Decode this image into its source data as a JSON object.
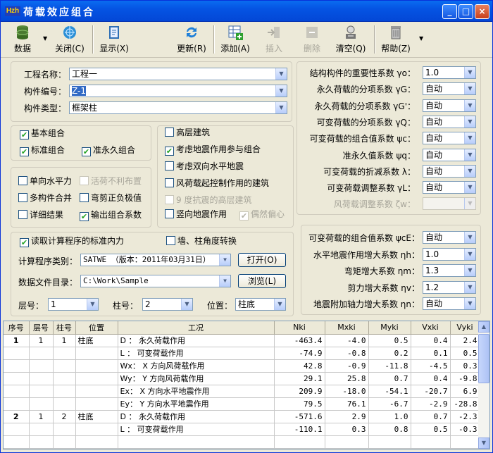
{
  "window": {
    "title": "荷载效应组合",
    "app_icon": "Hzh",
    "controls": [
      "_",
      "□",
      "×"
    ]
  },
  "toolbar": {
    "items": [
      {
        "label": "数据",
        "dropdown": true
      },
      {
        "label": "关闭(C)"
      },
      {
        "label": "显示(X)"
      },
      {
        "label": "更新(R)"
      },
      {
        "label": "添加(A)"
      },
      {
        "label": "插入",
        "disabled": true
      },
      {
        "label": "删除",
        "disabled": true
      },
      {
        "label": "清空(Q)"
      },
      {
        "label": "帮助(Z)",
        "dropdown": true
      }
    ]
  },
  "project": {
    "name_label": "工程名称：",
    "name_value": "工程一",
    "code_label": "构件编号：",
    "code_value": "Z-1",
    "type_label": "构件类型：",
    "type_value": "框架柱"
  },
  "combo_group": {
    "basic": {
      "label": "基本组合",
      "checked": true
    },
    "standard": {
      "label": "标准组合",
      "checked": true
    },
    "quasi": {
      "label": "准永久组合",
      "checked": true
    }
  },
  "options": [
    {
      "label": "单向水平力",
      "checked": false
    },
    {
      "label": "活荷不利布置",
      "checked": false,
      "disabled": true
    },
    {
      "label": "多构件合并",
      "checked": false
    },
    {
      "label": "弯剪正负极值",
      "checked": false
    },
    {
      "label": "详细结果",
      "checked": false
    },
    {
      "label": "输出组合系数",
      "checked": true
    }
  ],
  "seismic": [
    {
      "label": "高层建筑",
      "checked": false
    },
    {
      "label": "考虑地震作用参与组合",
      "checked": true
    },
    {
      "label": "考虑双向水平地震",
      "checked": false
    },
    {
      "label": "风荷载起控制作用的建筑",
      "checked": false
    },
    {
      "label": "9 度抗震的高层建筑",
      "checked": false,
      "disabled": true
    },
    {
      "label": "竖向地震作用",
      "checked": false
    },
    {
      "label": "偶然偏心",
      "checked": true,
      "disabled": true
    }
  ],
  "factors": [
    {
      "label": "结构构件的重要性系数 γo：",
      "value": "1.0"
    },
    {
      "label": "永久荷载的分项系数 γG：",
      "value": "自动"
    },
    {
      "label": "永久荷载的分项系数 γG'：",
      "value": "自动"
    },
    {
      "label": "可变荷载的分项系数 γQ：",
      "value": "自动"
    },
    {
      "label": "可变荷载的组合值系数 ψc：",
      "value": "自动"
    },
    {
      "label": "准永久值系数 ψq：",
      "value": "自动"
    },
    {
      "label": "可变荷载的折减系数 λ：",
      "value": "自动"
    },
    {
      "label": "可变荷载调整系数 γL：",
      "value": "自动"
    },
    {
      "label": "风荷载调整系数 ζw：",
      "value": "",
      "disabled": true
    }
  ],
  "read": {
    "label": "读取计算程序的标准内力",
    "checked": true,
    "rotate_label": "墙、柱角度转换",
    "rotate_checked": false,
    "program_label": "计算程序类别：",
    "program_value": "SATWE （版本：2011年03月31日）",
    "open_btn": "打开(O)",
    "dir_label": "数据文件目录：",
    "dir_value": "C:\\Work\\Sample",
    "browse_btn": "浏览(L)",
    "floor_label": "层号：",
    "floor_value": "1",
    "col_label": "柱号：",
    "col_value": "2",
    "pos_label": "位置：",
    "pos_value": "柱底"
  },
  "seismic_factors": [
    {
      "label": "可变荷载的组合值系数 ψcE：",
      "value": "自动"
    },
    {
      "label": "水平地震作用增大系数 ηh：",
      "value": "1.0"
    },
    {
      "label": "弯矩增大系数 ηm：",
      "value": "1.3"
    },
    {
      "label": "剪力增大系数 ηv：",
      "value": "1.2"
    },
    {
      "label": "地震附加轴力增大系数 ηn：",
      "value": "自动"
    }
  ],
  "table": {
    "headers": [
      "序号",
      "层号",
      "柱号",
      "位置",
      "工况",
      "Nki",
      "Mxki",
      "Myki",
      "Vxki",
      "Vyki"
    ],
    "rows": [
      [
        "1",
        "1",
        "1",
        "柱底",
        "D ： 永久荷载作用",
        "-463.4",
        "-4.0",
        "0.5",
        "0.4",
        "2.4"
      ],
      [
        "",
        "",
        "",
        "",
        "L ： 可变荷载作用",
        "-74.9",
        "-0.8",
        "0.2",
        "0.1",
        "0.5"
      ],
      [
        "",
        "",
        "",
        "",
        "Wx： X 方向风荷载作用",
        "42.8",
        "-0.9",
        "-11.8",
        "-4.5",
        "0.3"
      ],
      [
        "",
        "",
        "",
        "",
        "Wy： Y 方向风荷载作用",
        "29.1",
        "25.8",
        "0.7",
        "0.4",
        "-9.8"
      ],
      [
        "",
        "",
        "",
        "",
        "Ex： X 方向水平地震作用",
        "209.9",
        "-18.0",
        "-54.1",
        "-20.7",
        "6.9"
      ],
      [
        "",
        "",
        "",
        "",
        "Ey： Y 方向水平地震作用",
        "79.5",
        "76.1",
        "-6.7",
        "-2.9",
        "-28.8"
      ],
      [
        "2",
        "1",
        "2",
        "柱底",
        "D ： 永久荷载作用",
        "-571.6",
        "2.9",
        "1.0",
        "0.7",
        "-2.3"
      ],
      [
        "",
        "",
        "",
        "",
        "L ： 可变荷载作用",
        "-110.1",
        "0.3",
        "0.8",
        "0.5",
        "-0.3"
      ],
      [
        "",
        "",
        "",
        "",
        "",
        "",
        "",
        "",
        "",
        ""
      ]
    ]
  }
}
